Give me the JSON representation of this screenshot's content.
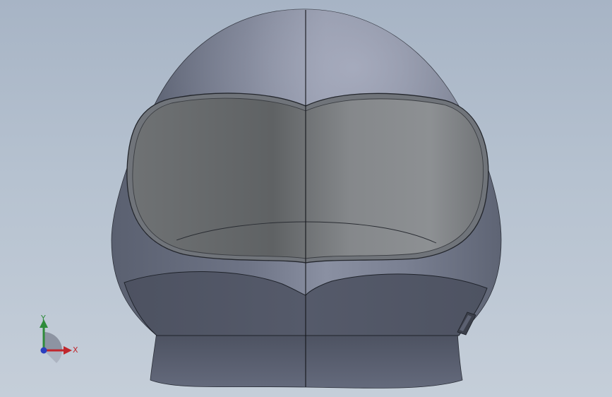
{
  "viewport": {
    "background_top": "#a7b4c5",
    "background_bottom": "#c5ced9"
  },
  "model": {
    "icon": "helmet-model",
    "shell_color": "#5d6373",
    "visor_color": "#7b7f85"
  },
  "triad": {
    "x_label": "X",
    "y_label": "Y",
    "x_color": "#c0272d",
    "y_color": "#2e8b3a",
    "z_color": "#2a3fbf"
  }
}
